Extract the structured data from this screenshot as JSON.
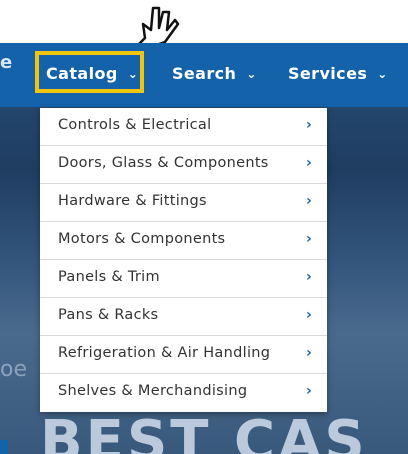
{
  "nav": {
    "items": [
      {
        "label": "Catalog",
        "chevron": "⌄"
      },
      {
        "label": "Search",
        "chevron": "⌄"
      },
      {
        "label": "Services",
        "chevron": "⌄"
      }
    ],
    "highlight_color": "#f1c40f",
    "bar_color": "#1462a9"
  },
  "dropdown": {
    "items": [
      {
        "label": "Controls & Electrical",
        "chevron": "›"
      },
      {
        "label": "Doors, Glass & Components",
        "chevron": "›"
      },
      {
        "label": "Hardware & Fittings",
        "chevron": "›"
      },
      {
        "label": "Motors & Components",
        "chevron": "›"
      },
      {
        "label": "Panels & Trim",
        "chevron": "›"
      },
      {
        "label": "Pans & Racks",
        "chevron": "›"
      },
      {
        "label": "Refrigeration & Air Handling",
        "chevron": "›"
      },
      {
        "label": "Shelves & Merchandising",
        "chevron": "›"
      }
    ],
    "chevron_color": "#1462a9"
  },
  "hero": {
    "text": "BEST CAS"
  },
  "icons": {
    "cursor": "hand-pointer-cursor-icon"
  }
}
